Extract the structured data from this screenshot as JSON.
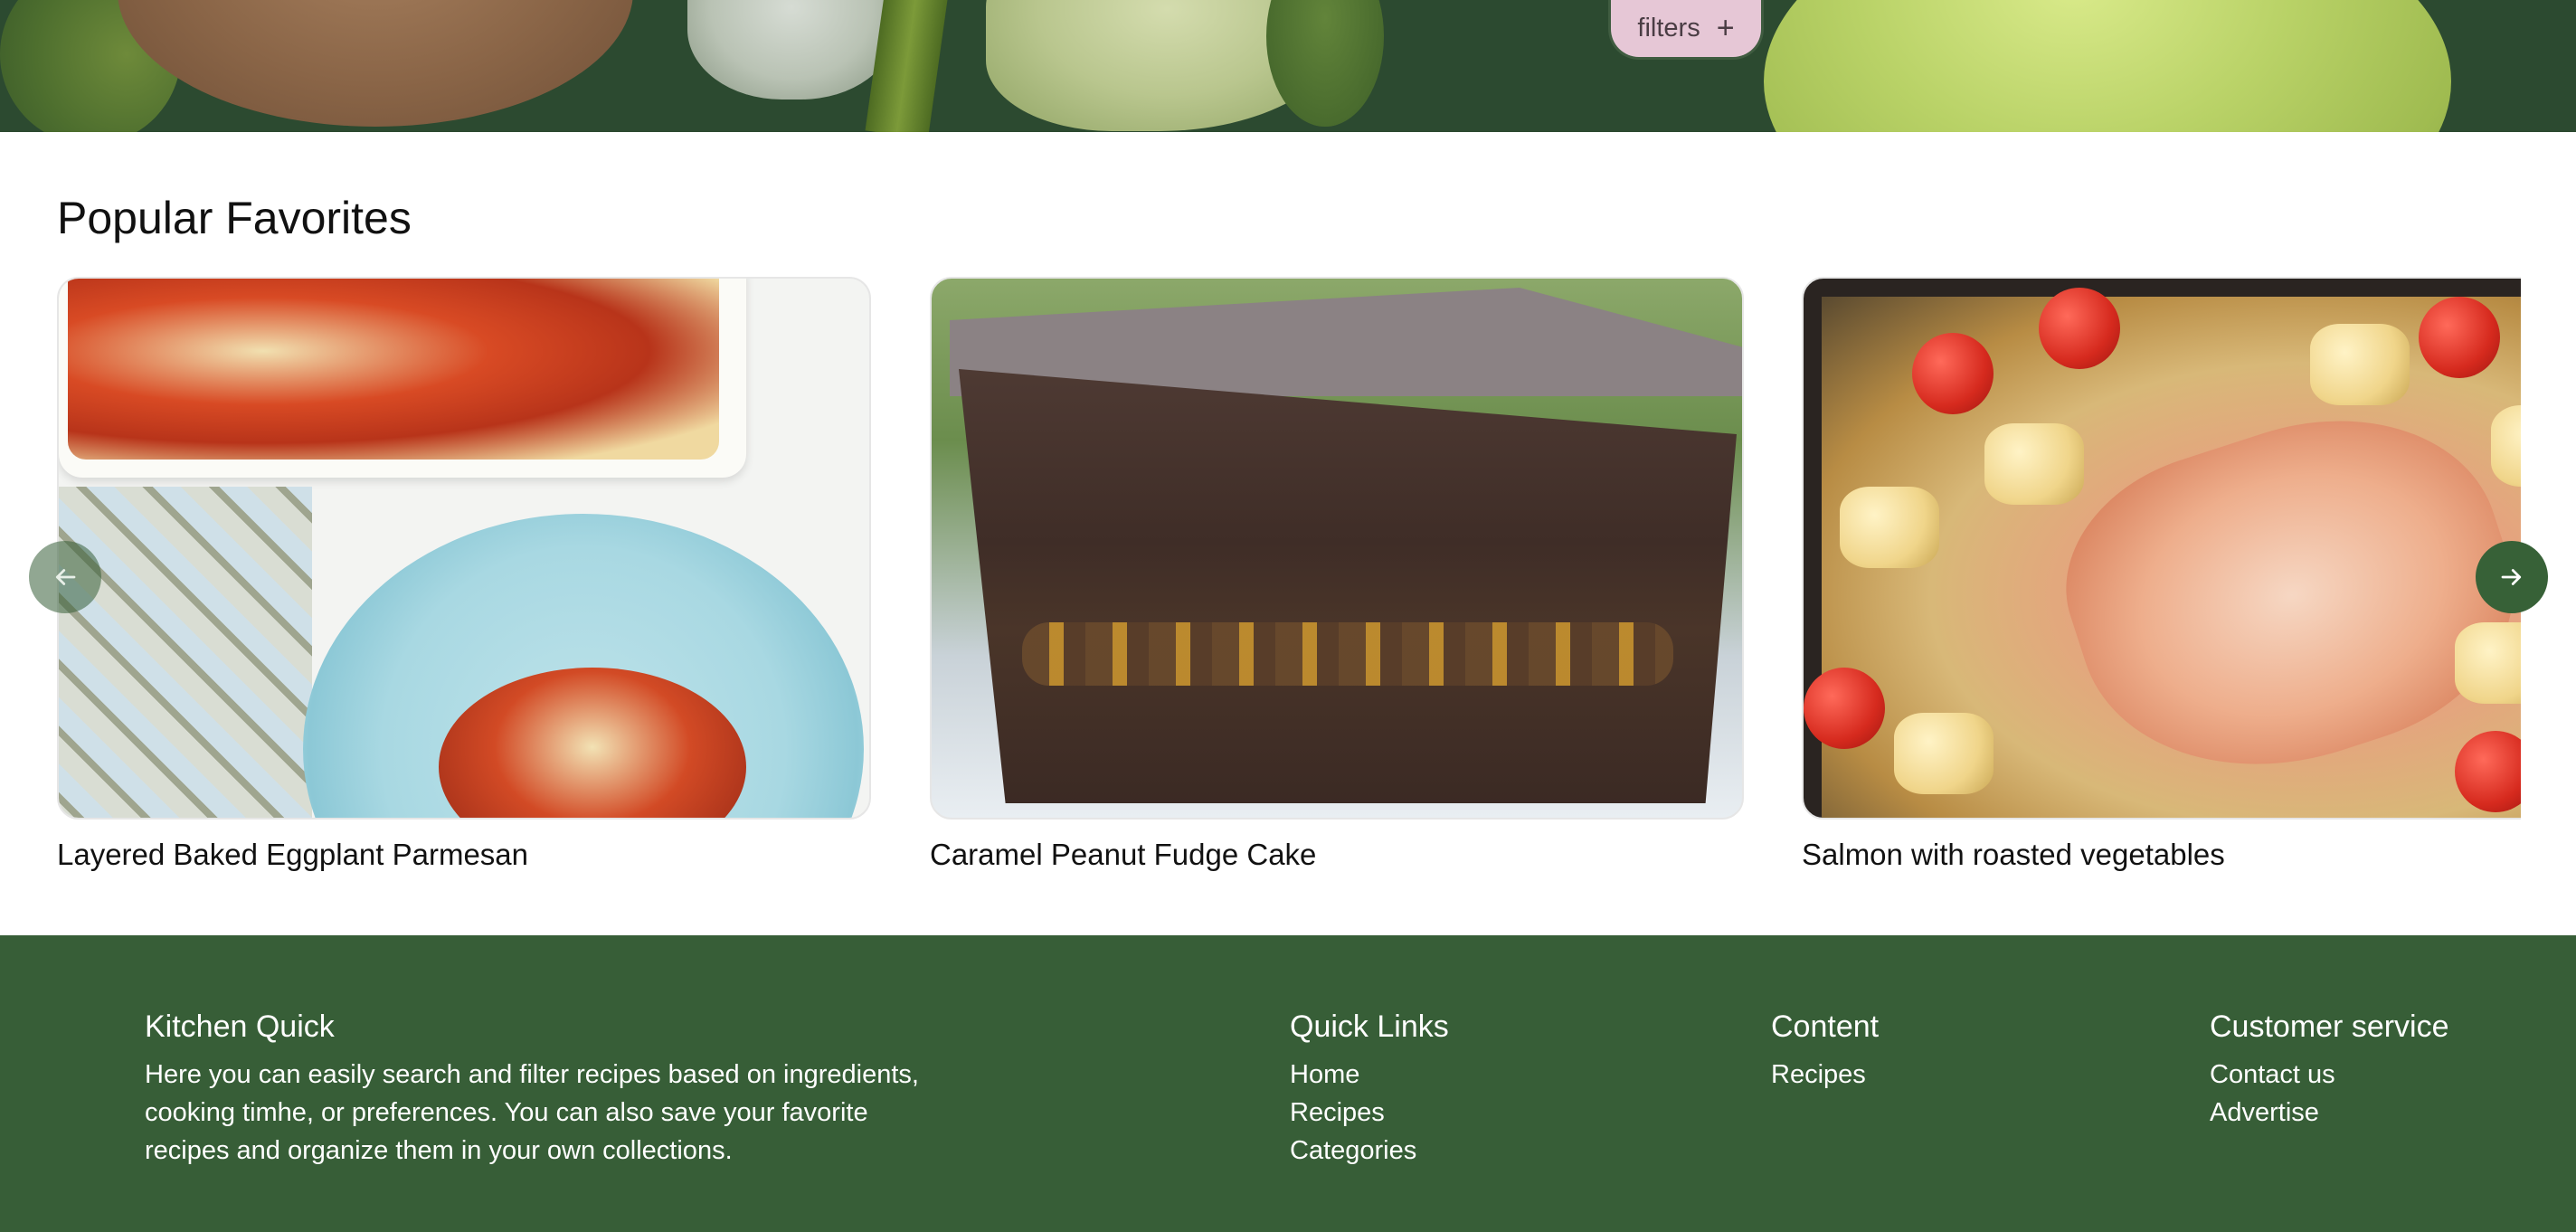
{
  "hero": {
    "filters_label": "filters",
    "filters_icon": "plus-icon"
  },
  "popular": {
    "title": "Popular Favorites",
    "cards": [
      {
        "title": "Layered Baked Eggplant Parmesan"
      },
      {
        "title": "Caramel Peanut Fudge Cake"
      },
      {
        "title": "Salmon with roasted vegetables"
      }
    ],
    "prev_icon": "arrow-left-icon",
    "next_icon": "arrow-right-icon"
  },
  "footer": {
    "brand": {
      "title": "Kitchen Quick",
      "description": "Here you can easily search and filter recipes based on ingredients, cooking timhe, or preferences. You can also save your favorite recipes and organize them in your own collections."
    },
    "quick_links": {
      "title": "Quick Links",
      "items": [
        "Home",
        "Recipes",
        "Categories"
      ]
    },
    "content": {
      "title": "Content",
      "items": [
        "Recipes"
      ]
    },
    "customer_service": {
      "title": "Customer service",
      "items": [
        "Contact us",
        "Advertise"
      ]
    }
  },
  "colors": {
    "footer_bg": "#375e37",
    "filters_bg": "#e6c7d6",
    "nav_button": "#376137"
  }
}
